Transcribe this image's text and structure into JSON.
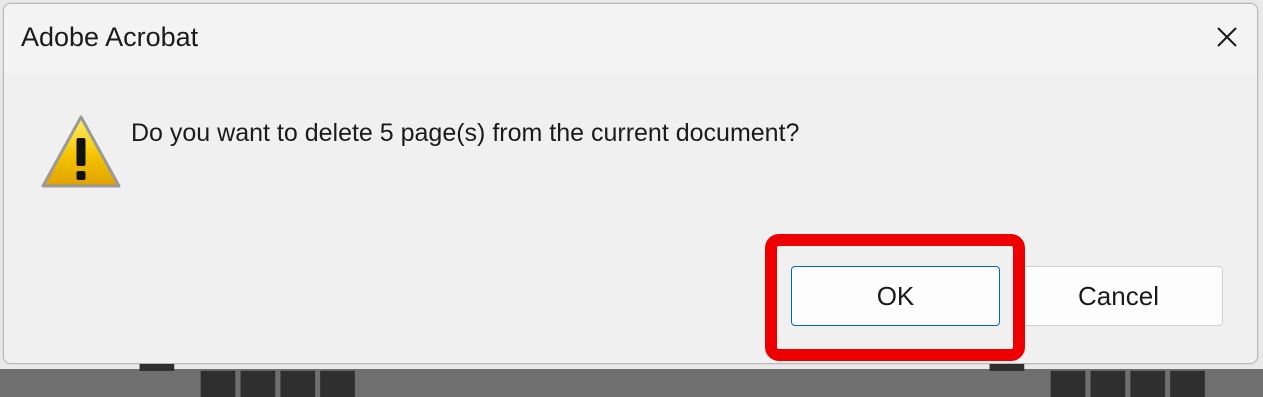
{
  "dialog": {
    "title": "Adobe Acrobat",
    "message": "Do you want to delete 5 page(s) from the current document?",
    "icon": "warning-icon"
  },
  "buttons": {
    "ok_label": "OK",
    "cancel_label": "Cancel"
  },
  "colors": {
    "dialog_background": "#f0f0f0",
    "titlebar_background": "#f3f3f3",
    "ok_border_accent": "#0067c0",
    "highlight_annotation": "#ee0000",
    "warning_fill": "#f5c400"
  }
}
